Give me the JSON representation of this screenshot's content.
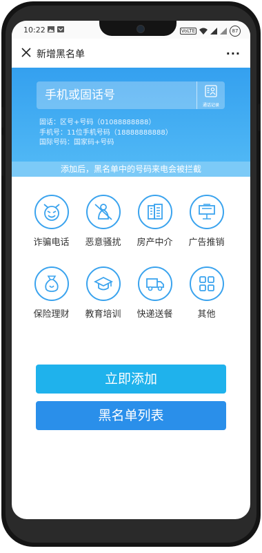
{
  "status": {
    "time": "10:22",
    "network": "VoLTE",
    "battery": "87"
  },
  "nav": {
    "title": "新增黑名单",
    "more": "···"
  },
  "input": {
    "placeholder": "手机或固话号",
    "record_label": "通话记录"
  },
  "hints": [
    "固话：区号+号码（01088888888）",
    "手机号：11位手机号码（18888888888）",
    "国际号码：国家码+号码"
  ],
  "notice": "添加后，黑名单中的号码来电会被拦截",
  "categories": [
    {
      "label": "诈骗电话",
      "icon": "devil-icon"
    },
    {
      "label": "恶意骚扰",
      "icon": "harassment-icon"
    },
    {
      "label": "房产中介",
      "icon": "building-icon"
    },
    {
      "label": "广告推销",
      "icon": "billboard-icon"
    },
    {
      "label": "保险理财",
      "icon": "money-bag-icon"
    },
    {
      "label": "教育培训",
      "icon": "graduation-cap-icon"
    },
    {
      "label": "快递送餐",
      "icon": "delivery-truck-icon"
    },
    {
      "label": "其他",
      "icon": "grid-icon"
    }
  ],
  "buttons": {
    "add": "立即添加",
    "list": "黑名单列表"
  },
  "colors": {
    "accent": "#3aa3ee",
    "banner": "#34a0ef",
    "add_button": "#1fb2ec",
    "list_button": "#2a8fea"
  }
}
